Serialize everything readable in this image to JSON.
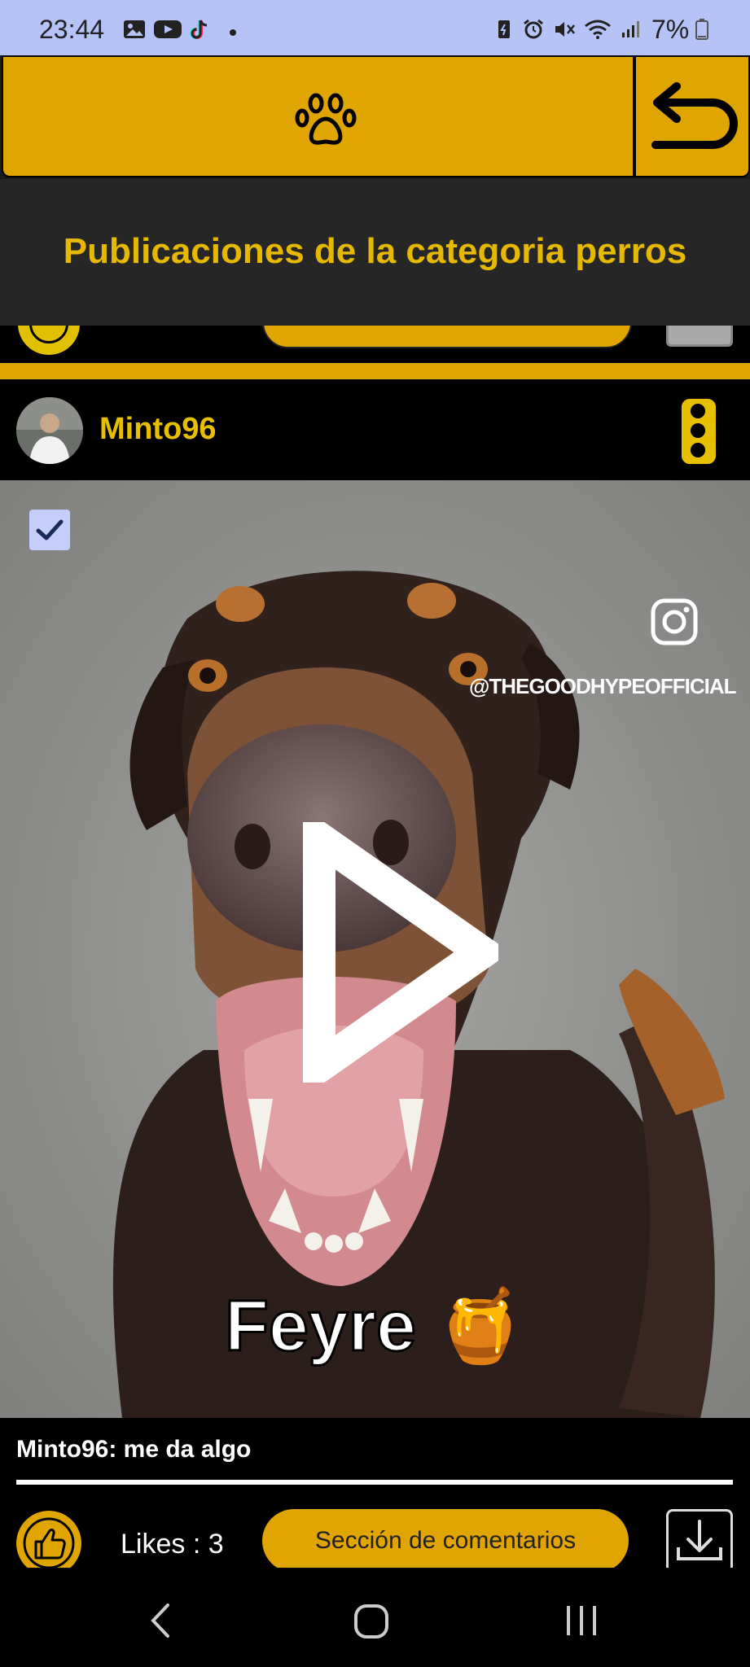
{
  "status_bar": {
    "time": "23:44",
    "battery": "7%"
  },
  "header": {
    "title": "Publicaciones de la categoria perros",
    "left_icon": "paw-icon",
    "right_icon": "back-arrow-icon"
  },
  "post": {
    "username": "Minto96",
    "watermark_handle": "@THEGOODHYPEOFFICIAL",
    "video_caption": "Feyre 🍯",
    "comment": "Minto96: me da algo",
    "likes": "Likes : 3",
    "comments_button": "Sección de comentarios"
  },
  "colors": {
    "accent": "#e0a500",
    "title": "#e6b800",
    "status_bar": "#b5c3f7"
  }
}
